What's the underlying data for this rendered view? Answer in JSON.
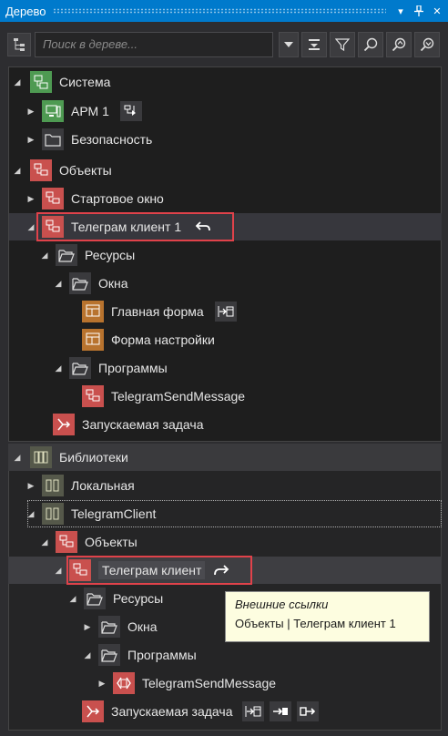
{
  "window": {
    "title": "Дерево",
    "pin_label": "▾",
    "pushpin": "⊥",
    "close": "✕"
  },
  "toolbar": {
    "search_placeholder": "Поиск в дереве..."
  },
  "tree_top": {
    "sistema": "Система",
    "arm": "АРМ 1",
    "security": "Безопасность",
    "objects": "Объекты",
    "start_window": "Стартовое окно",
    "telegram_client_1": "Телеграм клиент 1",
    "resources": "Ресурсы",
    "windows": "Окна",
    "main_form": "Главная форма",
    "settings_form": "Форма настройки",
    "programs": "Программы",
    "send_message": "TelegramSendMessage",
    "launch_task": "Запускаемая задача"
  },
  "tree_lib": {
    "libraries": "Библиотеки",
    "local": "Локальная",
    "telegram_client_lib": "TelegramClient",
    "objects": "Объекты",
    "telegram_client": "Телеграм клиент",
    "resources": "Ресурсы",
    "windows": "Окна",
    "programs": "Программы",
    "send_message": "TelegramSendMessage",
    "launch_task": "Запускаемая задача"
  },
  "tooltip": {
    "title": "Внешние ссылки",
    "text": "Объекты | Телеграм клиент 1"
  },
  "colors": {
    "accent": "#007acc",
    "highlight": "#e0424a",
    "green_icon": "#4caf50",
    "red_icon": "#d9534f",
    "orange_icon": "#b8732e"
  }
}
